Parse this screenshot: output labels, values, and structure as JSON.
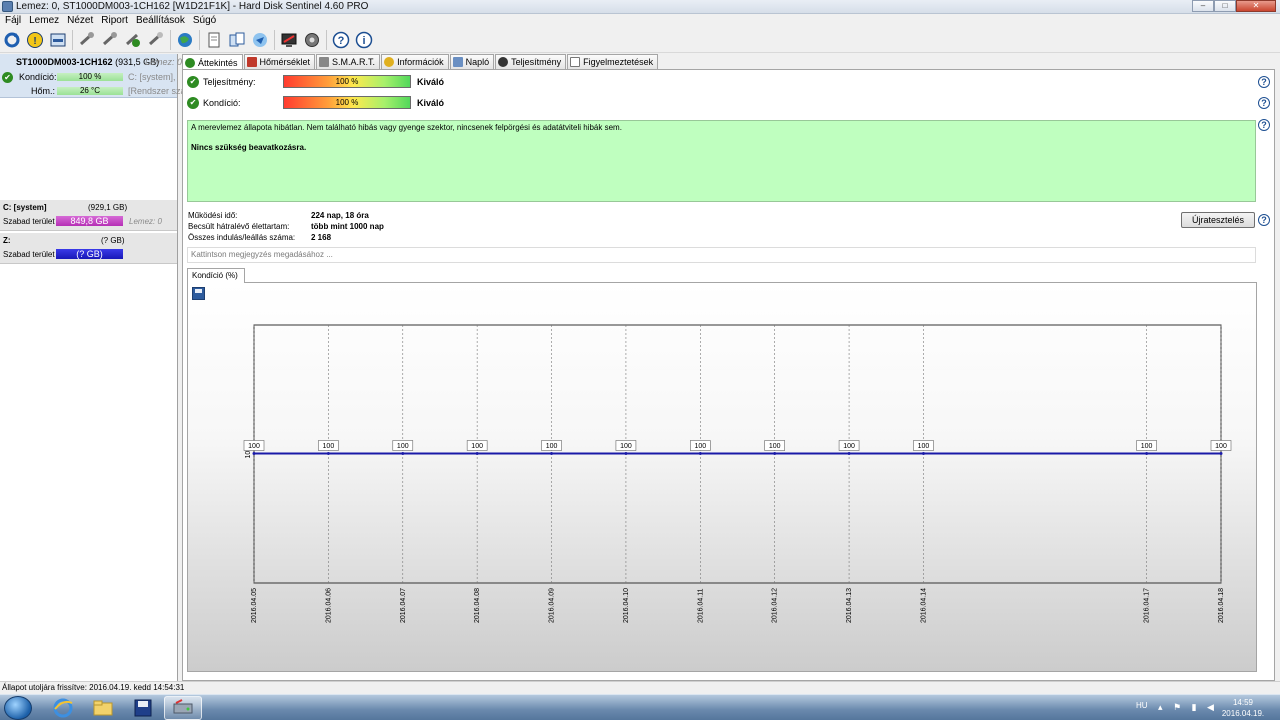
{
  "window": {
    "title": "Lemez: 0, ST1000DM003-1CH162 [W1D21F1K]  -  Hard Disk Sentinel 4.60 PRO",
    "btn_min": "–",
    "btn_max": "□",
    "btn_close": "✕"
  },
  "menu": [
    "Fájl",
    "Lemez",
    "Nézet",
    "Riport",
    "Beállítások",
    "Súgó"
  ],
  "disk": {
    "name": "ST1000DM003-1CH162",
    "size": "(931,5 GB)",
    "lemez": "Lemez: 0",
    "condition_label": "Kondíció:",
    "condition_value": "100 %",
    "condition_note": "C: [system],",
    "temp_label": "Hőm.:",
    "temp_value": "26 °C",
    "temp_note": "[Rendszer szá"
  },
  "volumes": [
    {
      "name": "C: [system]",
      "size": "(929,1 GB)",
      "free_label": "Szabad terület",
      "free_value": "849,8 GB",
      "note": "Lemez: 0",
      "color": "#c040c0"
    },
    {
      "name": "Z:",
      "size": "(? GB)",
      "free_label": "Szabad terület",
      "free_value": "(? GB)",
      "note": "",
      "color": "#2020d0"
    }
  ],
  "tabs": [
    "Áttekintés",
    "Hőmérséklet",
    "S.M.A.R.T.",
    "Információk",
    "Napló",
    "Teljesítmény",
    "Figyelmeztetések"
  ],
  "overview": {
    "perf_label": "Teljesítmény:",
    "perf_value": "100 %",
    "perf_rating": "Kiváló",
    "cond_label": "Kondíció:",
    "cond_value": "100 %",
    "cond_rating": "Kiváló",
    "status_text": "A merevlemez állapota hibátlan. Nem található hibás vagy gyenge szektor, nincsenek felpörgési és adatátviteli hibák sem.",
    "action_text": "Nincs szükség beavatkozásra.",
    "uptime_label": "Működési idő:",
    "uptime_value": "224 nap, 18 óra",
    "life_label": "Becsült hátralévő élettartam:",
    "life_value": "több mint 1000 nap",
    "starts_label": "Összes indulás/leállás száma:",
    "starts_value": "2 168",
    "retest_label": "Újratesztelés",
    "note_placeholder": "Kattintson megjegyzés megadásához ...",
    "help": "?"
  },
  "chart_tab": "Kondíció  (%)",
  "chart_data": {
    "type": "line",
    "title": "",
    "xlabel": "",
    "ylabel": "",
    "y_tick": "100",
    "x": [
      "2016.04.05",
      "2016.04.06",
      "2016.04.07",
      "2016.04.08",
      "2016.04.09",
      "2016.04.10",
      "2016.04.11",
      "2016.04.12",
      "2016.04.13",
      "2016.04.14",
      "2016.04.17",
      "2016.04.18"
    ],
    "day_index": [
      0,
      1,
      2,
      3,
      4,
      5,
      6,
      7,
      8,
      9,
      12,
      13
    ],
    "values": [
      100,
      100,
      100,
      100,
      100,
      100,
      100,
      100,
      100,
      100,
      100,
      100
    ],
    "line_color": "#1a1aa8",
    "grid": true
  },
  "statusbar": "Állapot utoljára frissítve: 2016.04.19. kedd 14:54:31",
  "taskbar": {
    "lang": "HU",
    "time": "14:59",
    "date": "2016.04.19."
  }
}
